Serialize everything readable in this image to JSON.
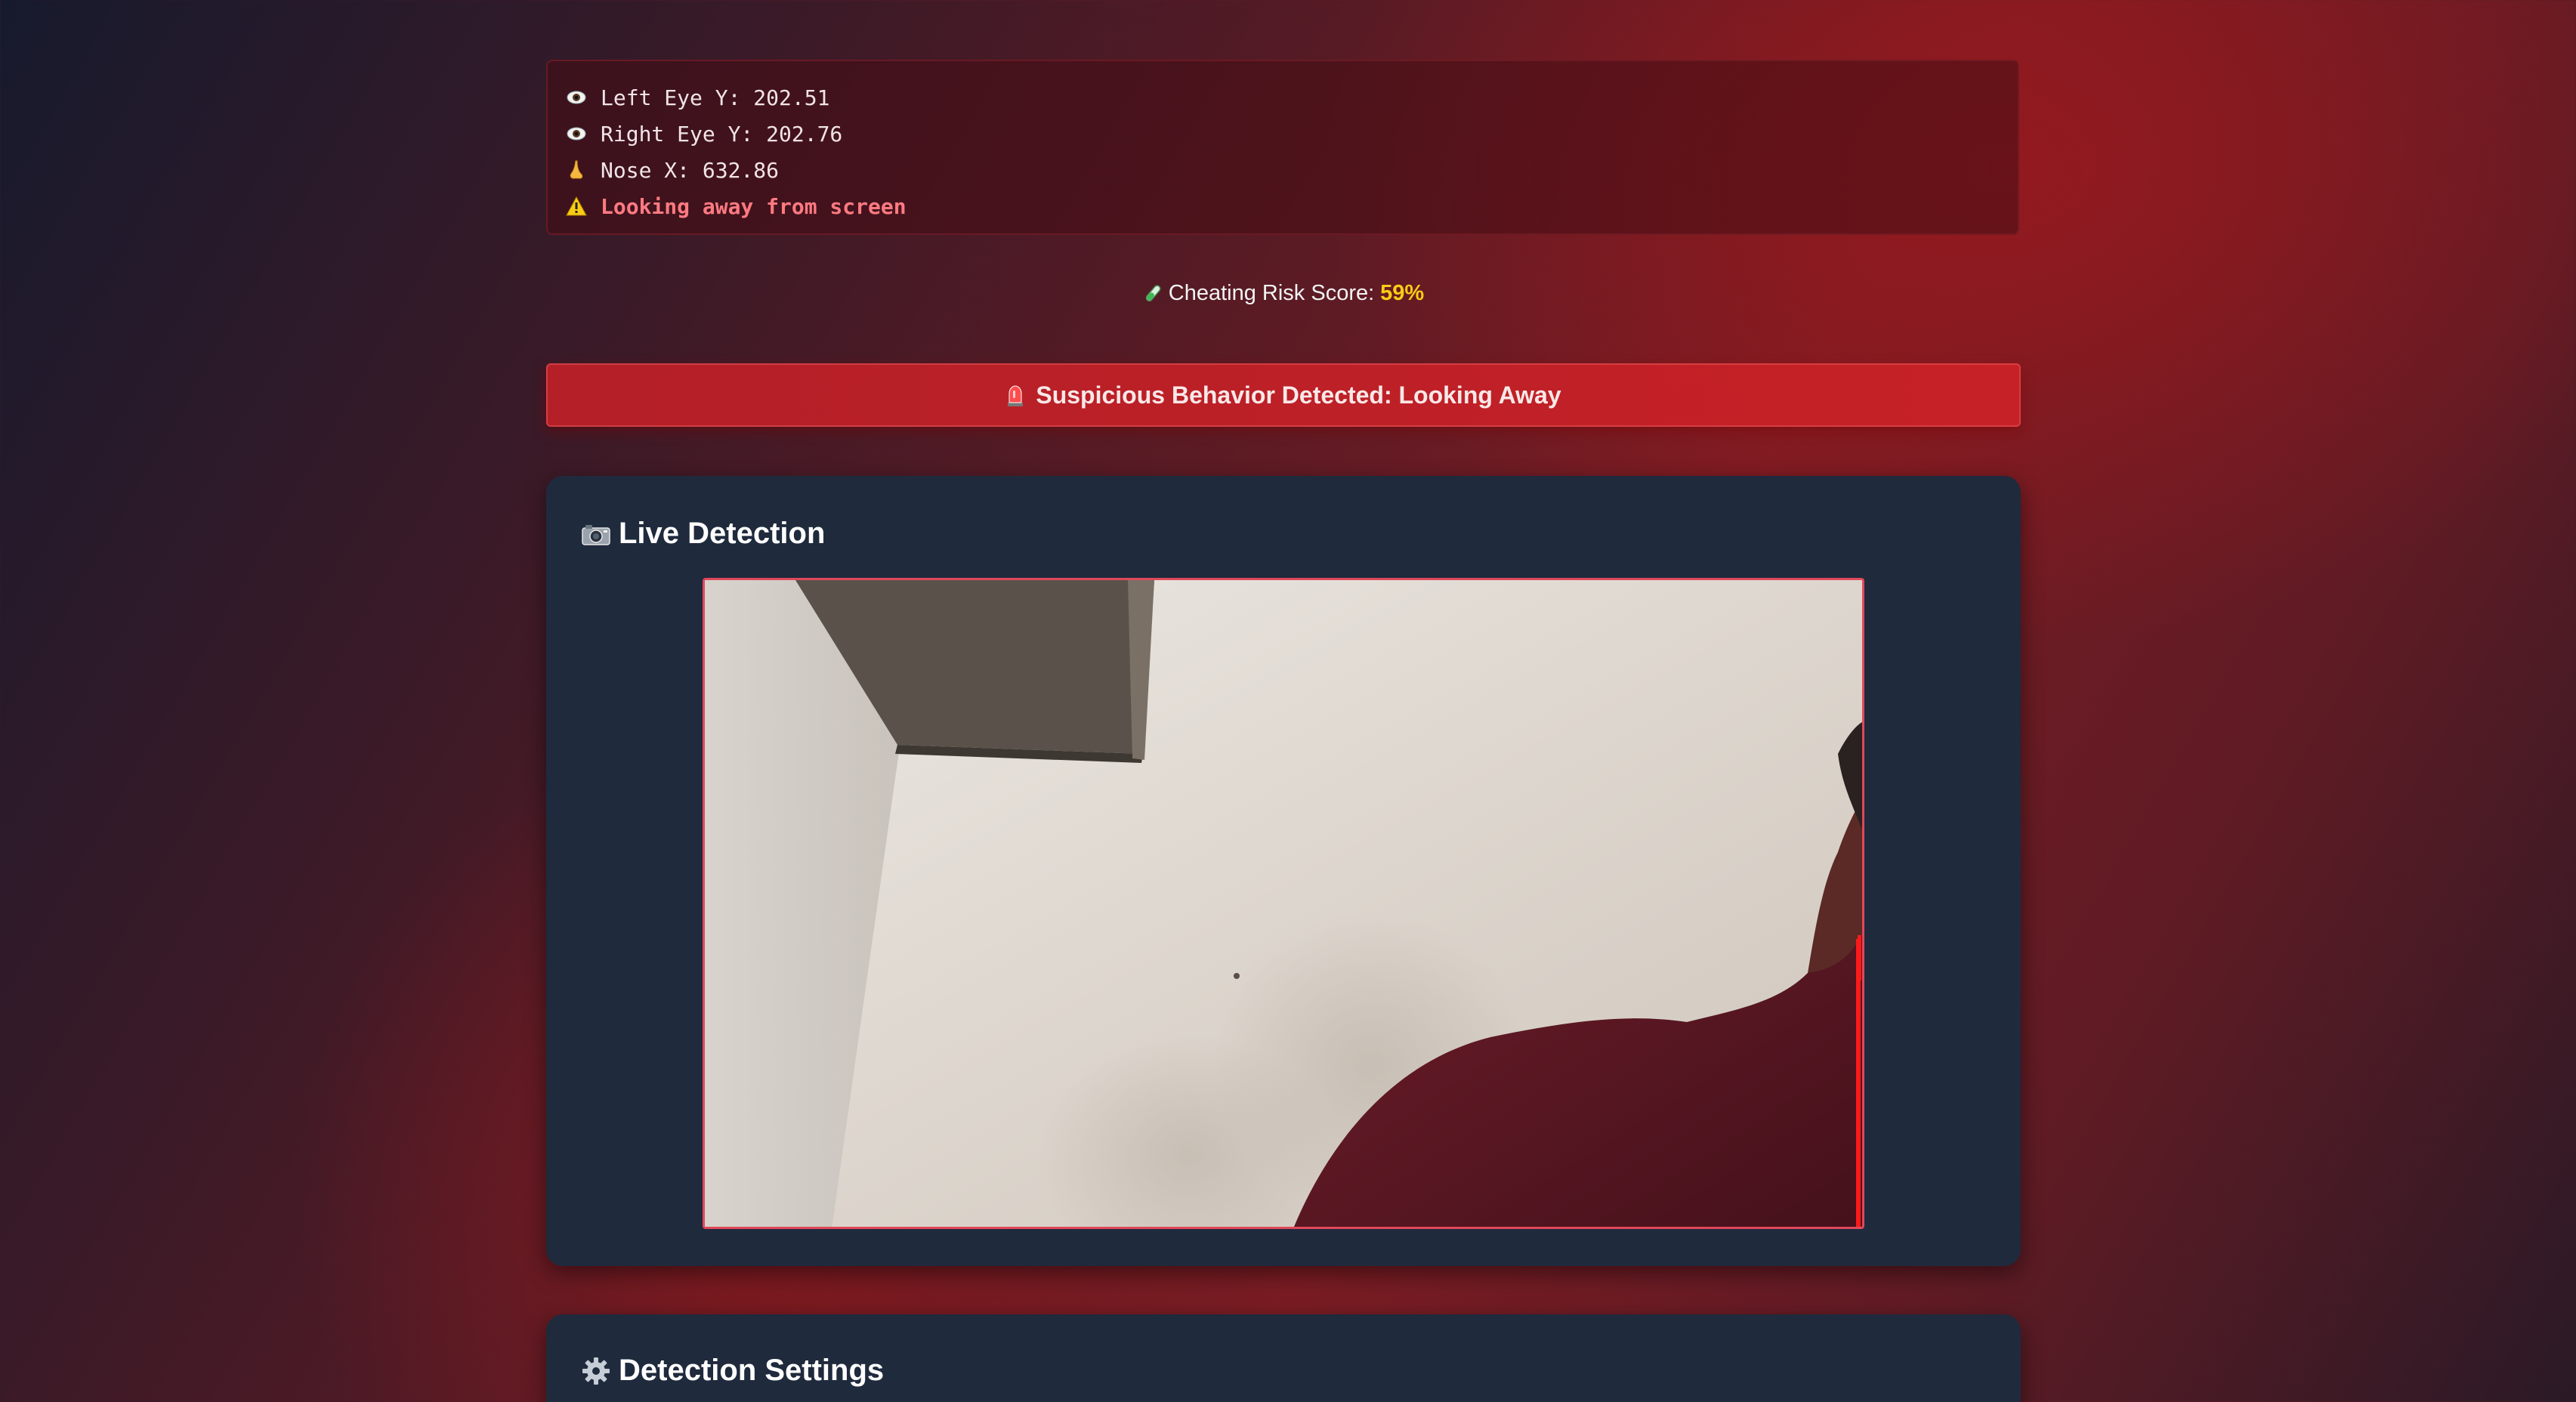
{
  "telemetry": {
    "left_eye": "Left Eye Y: 202.51",
    "right_eye": "Right Eye Y: 202.76",
    "nose": "Nose X: 632.86",
    "warning": "Looking away from screen"
  },
  "risk": {
    "label": "Cheating Risk Score:",
    "value": "59%"
  },
  "alert": {
    "text": "Suspicious Behavior Detected: Looking Away"
  },
  "live": {
    "title": "Live Detection"
  },
  "settings": {
    "title": "Detection Settings"
  },
  "icons": {
    "eye": "eye-icon",
    "nose": "nose-icon",
    "warning": "warning-icon",
    "risk": "test-tube-icon",
    "alert": "siren-icon",
    "camera": "camera-icon",
    "gear": "gear-icon"
  },
  "colors": {
    "warning_text": "#ff7a82",
    "risk_value": "#facc15",
    "alert_bg": "#c62126",
    "card_bg": "#1f2a3d",
    "video_border": "#e0485a"
  }
}
